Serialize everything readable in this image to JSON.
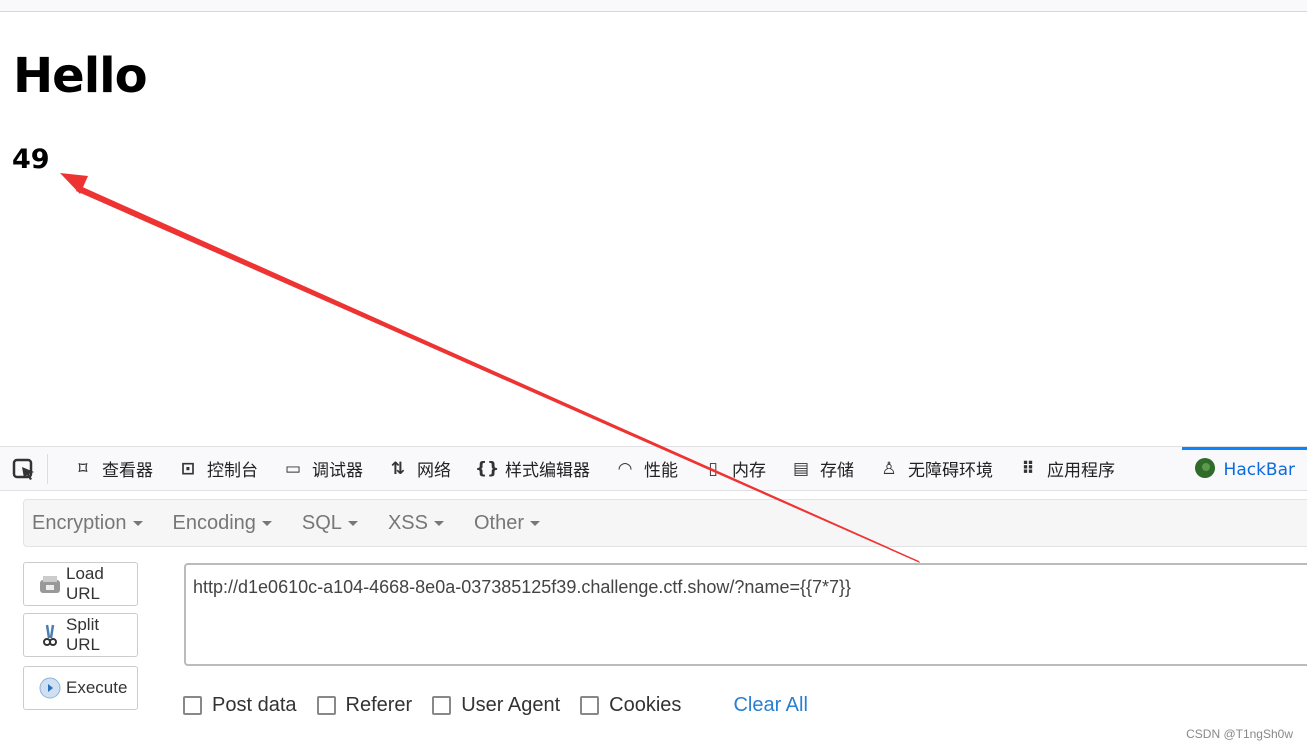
{
  "page": {
    "heading": "Hello",
    "result": "49"
  },
  "devtools": {
    "tabs": [
      {
        "label": "查看器",
        "icon": "inspector-icon"
      },
      {
        "label": "控制台",
        "icon": "console-icon"
      },
      {
        "label": "调试器",
        "icon": "debugger-icon"
      },
      {
        "label": "网络",
        "icon": "network-icon"
      },
      {
        "label": "样式编辑器",
        "icon": "style-editor-icon"
      },
      {
        "label": "性能",
        "icon": "performance-icon"
      },
      {
        "label": "内存",
        "icon": "memory-icon"
      },
      {
        "label": "存储",
        "icon": "storage-icon"
      },
      {
        "label": "无障碍环境",
        "icon": "accessibility-icon"
      },
      {
        "label": "应用程序",
        "icon": "application-icon"
      },
      {
        "label": "HackBar",
        "icon": "hackbar-icon",
        "active": true
      }
    ]
  },
  "hackbar": {
    "menus": [
      "Encryption",
      "Encoding",
      "SQL",
      "XSS",
      "Other"
    ],
    "buttons": {
      "load": "Load URL",
      "split": "Split URL",
      "execute": "Execute"
    },
    "url": "http://d1e0610c-a104-4668-8e0a-037385125f39.challenge.ctf.show/?name={{7*7}}",
    "checks": [
      "Post data",
      "Referer",
      "User Agent",
      "Cookies"
    ],
    "clear": "Clear All"
  },
  "watermark": "CSDN @T1ngSh0w",
  "colors": {
    "annotation_arrow": "#ee3333",
    "active_tab": "#0a84ff"
  }
}
